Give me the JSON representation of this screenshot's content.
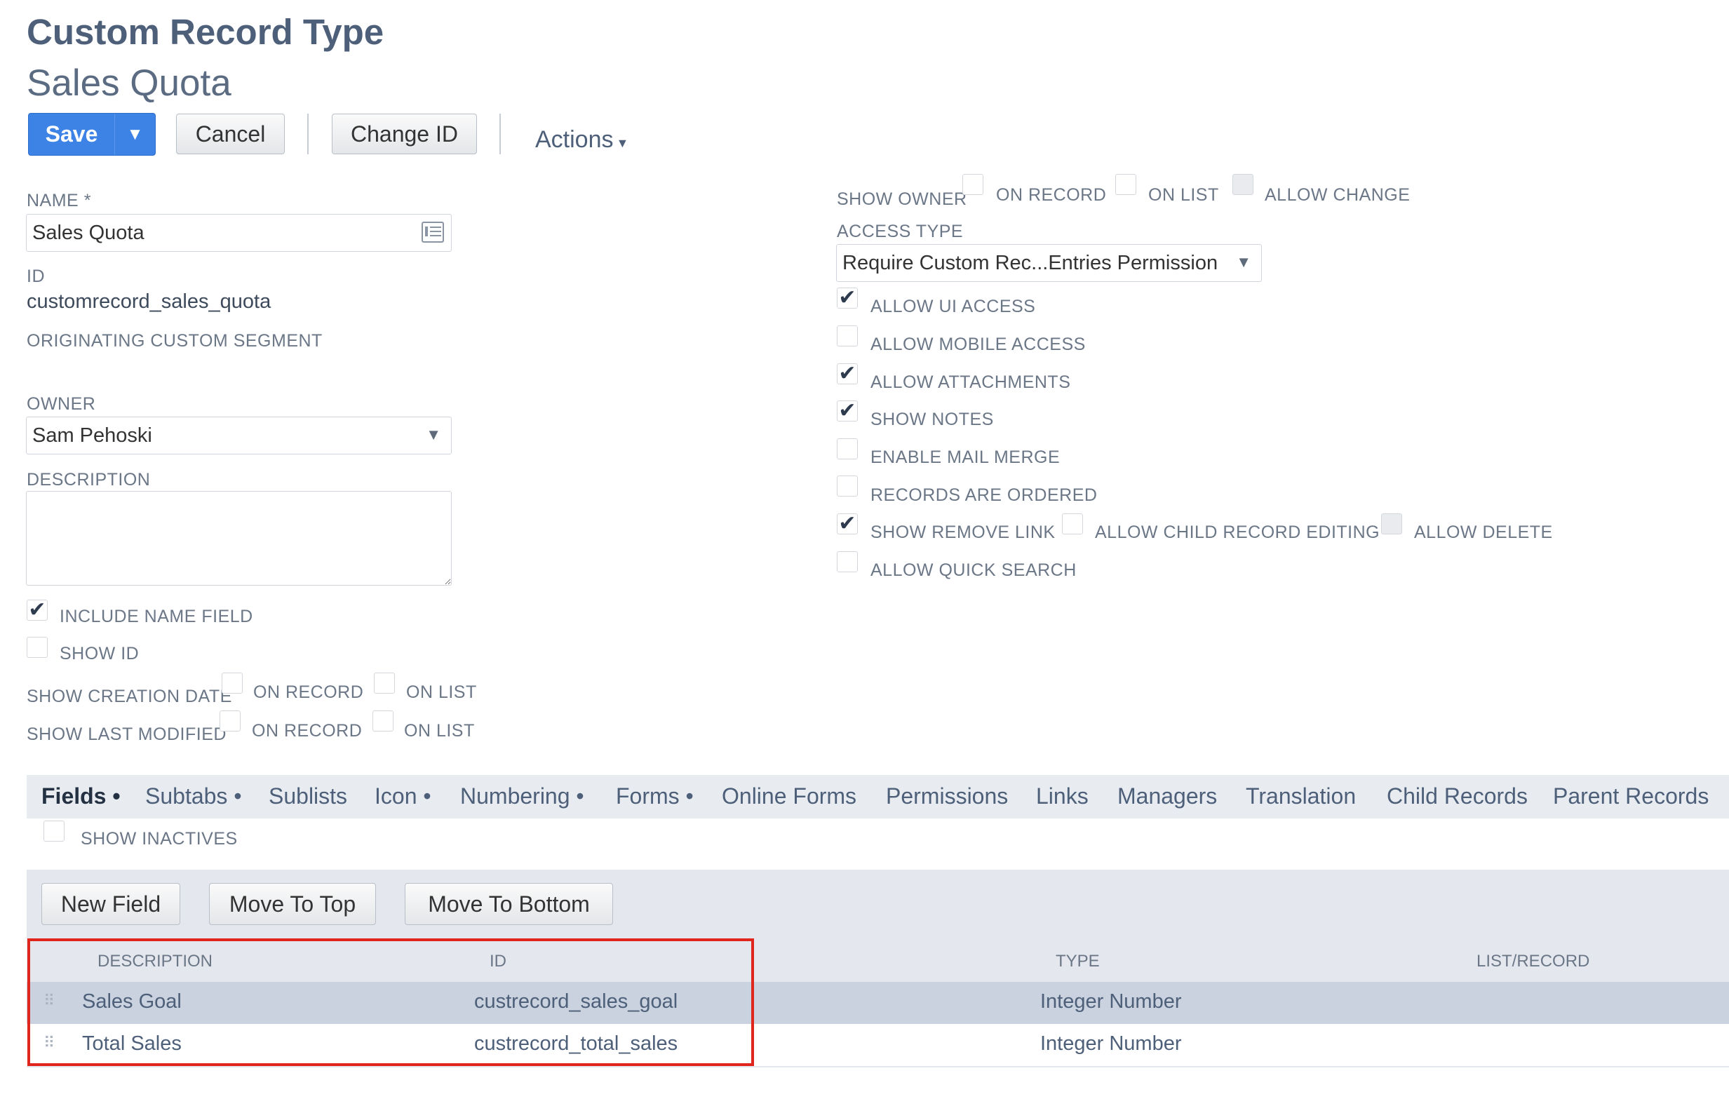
{
  "header": {
    "record_type": "Custom Record Type",
    "record_name": "Sales Quota"
  },
  "toolbar": {
    "save": "Save",
    "cancel": "Cancel",
    "change_id": "Change ID",
    "actions": "Actions"
  },
  "left": {
    "name_label": "NAME",
    "required_mark": "*",
    "name_value": "Sales Quota",
    "id_label": "ID",
    "id_value": "customrecord_sales_quota",
    "segment_label": "ORIGINATING CUSTOM SEGMENT",
    "owner_label": "OWNER",
    "owner_value": "Sam Pehoski",
    "description_label": "DESCRIPTION",
    "description_value": "",
    "include_name_field": {
      "label": "INCLUDE NAME FIELD",
      "checked": true
    },
    "show_id": {
      "label": "SHOW ID",
      "checked": false
    },
    "show_creation_date": {
      "label": "SHOW CREATION DATE",
      "on_record": "ON RECORD",
      "on_list": "ON LIST"
    },
    "show_last_modified": {
      "label": "SHOW LAST MODIFIED",
      "on_record": "ON RECORD",
      "on_list": "ON LIST"
    }
  },
  "right": {
    "show_owner": {
      "label": "SHOW OWNER",
      "on_record": "ON RECORD",
      "on_list": "ON LIST",
      "allow_change": "ALLOW CHANGE"
    },
    "access_type_label": "ACCESS TYPE",
    "access_type_value": "Require Custom Rec...Entries Permission",
    "options": [
      {
        "label": "ALLOW UI ACCESS",
        "checked": true
      },
      {
        "label": "ALLOW MOBILE ACCESS",
        "checked": false
      },
      {
        "label": "ALLOW ATTACHMENTS",
        "checked": true
      },
      {
        "label": "SHOW NOTES",
        "checked": true
      },
      {
        "label": "ENABLE MAIL MERGE",
        "checked": false
      },
      {
        "label": "RECORDS ARE ORDERED",
        "checked": false
      },
      {
        "label": "SHOW REMOVE LINK",
        "checked": true
      },
      {
        "label": "ALLOW QUICK SEARCH",
        "checked": false
      }
    ],
    "allow_child_record_editing": "ALLOW CHILD RECORD EDITING",
    "allow_delete": "ALLOW DELETE"
  },
  "tabs": [
    "Fields •",
    "Subtabs •",
    "Sublists",
    "Icon •",
    "Numbering •",
    "Forms •",
    "Online Forms",
    "Permissions",
    "Links",
    "Managers",
    "Translation",
    "Child Records",
    "Parent Records"
  ],
  "fields_tab": {
    "show_inactives": "SHOW INACTIVES",
    "buttons": {
      "new_field": "New Field",
      "move_to_top": "Move To Top",
      "move_to_bottom": "Move To Bottom"
    },
    "columns": [
      "DESCRIPTION",
      "ID",
      "TYPE",
      "LIST/RECORD"
    ],
    "rows": [
      {
        "description": "Sales Goal",
        "id": "custrecord_sales_goal",
        "type": "Integer Number",
        "list_record": ""
      },
      {
        "description": "Total Sales",
        "id": "custrecord_total_sales",
        "type": "Integer Number",
        "list_record": ""
      }
    ]
  },
  "colors": {
    "primary_button": "#3d83e5",
    "highlight_box": "#e0261c",
    "selected_row": "#c9d2de"
  }
}
